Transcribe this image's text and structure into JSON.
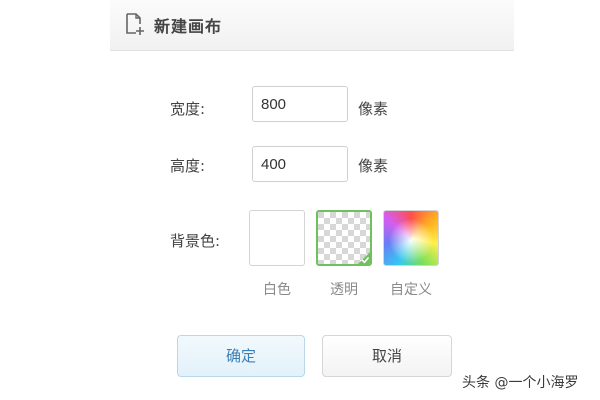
{
  "dialog": {
    "title": "新建画布",
    "icon": "new-file-icon",
    "width_label": "宽度:",
    "width_value": "800",
    "width_unit": "像素",
    "height_label": "高度:",
    "height_value": "400",
    "height_unit": "像素",
    "background_label": "背景色:",
    "background_options": [
      {
        "label": "白色",
        "selected": false
      },
      {
        "label": "透明",
        "selected": true
      },
      {
        "label": "自定义",
        "selected": false
      }
    ],
    "confirm_label": "确定",
    "cancel_label": "取消"
  },
  "watermark": "头条 @一个小海罗",
  "colors": {
    "selected_border": "#6fc15c",
    "confirm_text": "#3a7fb5"
  }
}
